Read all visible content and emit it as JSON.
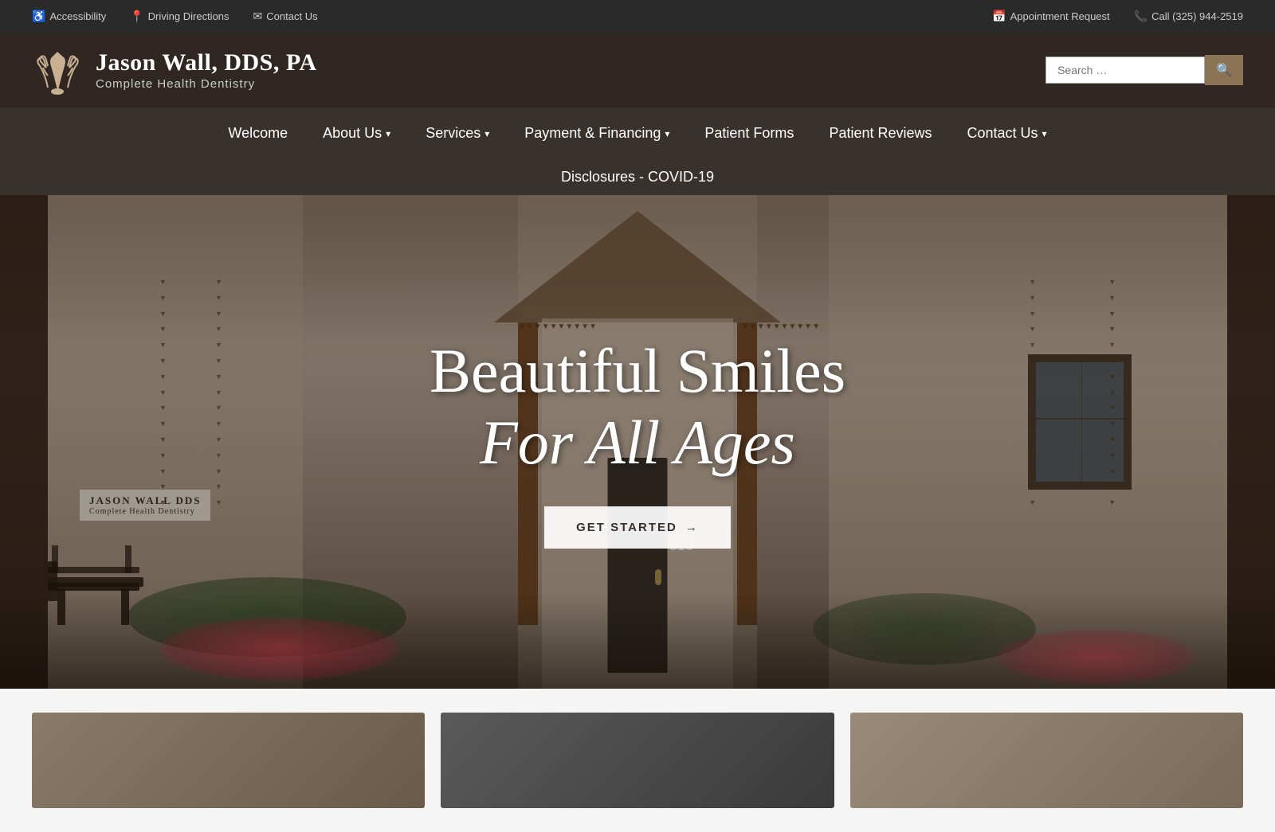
{
  "topbar": {
    "left": [
      {
        "id": "accessibility",
        "icon": "♿",
        "label": "Accessibility"
      },
      {
        "id": "directions",
        "icon": "📍",
        "label": "Driving Directions"
      },
      {
        "id": "contact-top",
        "icon": "✉",
        "label": "Contact Us"
      }
    ],
    "right": [
      {
        "id": "appointment",
        "icon": "📅",
        "label": "Appointment Request"
      },
      {
        "id": "phone",
        "icon": "📞",
        "label": "Call (325) 944-2519"
      }
    ]
  },
  "header": {
    "logo": {
      "name": "Jason Wall, DDS, PA",
      "sub": "Complete Health Dentistry"
    },
    "search": {
      "placeholder": "Search …",
      "button_label": "🔍"
    }
  },
  "nav": {
    "items": [
      {
        "id": "welcome",
        "label": "Welcome",
        "has_dropdown": false
      },
      {
        "id": "about",
        "label": "About Us",
        "has_dropdown": true
      },
      {
        "id": "services",
        "label": "Services",
        "has_dropdown": true
      },
      {
        "id": "payment",
        "label": "Payment & Financing",
        "has_dropdown": true
      },
      {
        "id": "patient-forms",
        "label": "Patient Forms",
        "has_dropdown": false
      },
      {
        "id": "patient-reviews",
        "label": "Patient Reviews",
        "has_dropdown": false
      },
      {
        "id": "contact",
        "label": "Contact Us",
        "has_dropdown": true
      }
    ],
    "row2": [
      {
        "id": "disclosures",
        "label": "Disclosures - COVID-19"
      }
    ]
  },
  "hero": {
    "title_line1": "Beautiful Smiles",
    "title_line2": "For All Ages",
    "cta_label": "GET STARTED",
    "cta_arrow": "→"
  },
  "building_sign": {
    "line1": "JASON WALL DDS",
    "line2": "Complete Health Dentistry"
  }
}
